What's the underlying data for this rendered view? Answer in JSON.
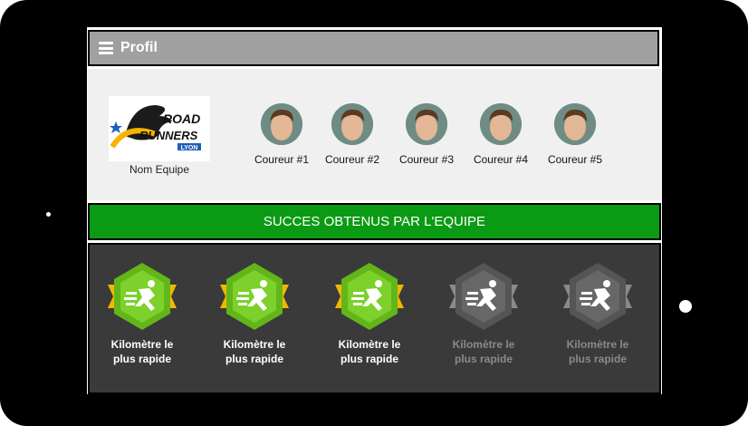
{
  "header": {
    "title": "Profil",
    "menu_icon": "hamburger-icon"
  },
  "team": {
    "name": "Nom Equipe",
    "logo": {
      "line1": "ROAD",
      "line2": "RUNNERS",
      "line3": "LYON"
    }
  },
  "runners": [
    {
      "label": "Coureur #1"
    },
    {
      "label": "Coureur #2"
    },
    {
      "label": "Coureur #3"
    },
    {
      "label": "Coureur #4"
    },
    {
      "label": "Coureur #5"
    }
  ],
  "success_banner": {
    "text": "SUCCES OBTENUS PAR L'EQUIPE"
  },
  "badges": [
    {
      "line1": "Kilomètre le",
      "line2": "plus rapide",
      "unlocked": true,
      "icon": "runner-icon"
    },
    {
      "line1": "Kilomètre le",
      "line2": "plus rapide",
      "unlocked": true,
      "icon": "runner-icon"
    },
    {
      "line1": "Kilomètre le",
      "line2": "plus rapide",
      "unlocked": true,
      "icon": "runner-icon"
    },
    {
      "line1": "Kilomètre le",
      "line2": "plus rapide",
      "unlocked": false,
      "icon": "runner-icon"
    },
    {
      "line1": "Kilomètre le",
      "line2": "plus rapide",
      "unlocked": false,
      "icon": "runner-icon"
    }
  ],
  "colors": {
    "header_bg": "#a0a0a0",
    "team_panel_bg": "#f0f0f0",
    "success_green": "#0b9a14",
    "badges_bg": "#3a3a3a",
    "badge_unlocked": "#6fbf1f",
    "badge_ribbon": "#f2b800",
    "badge_locked": "#5e5e5e"
  }
}
